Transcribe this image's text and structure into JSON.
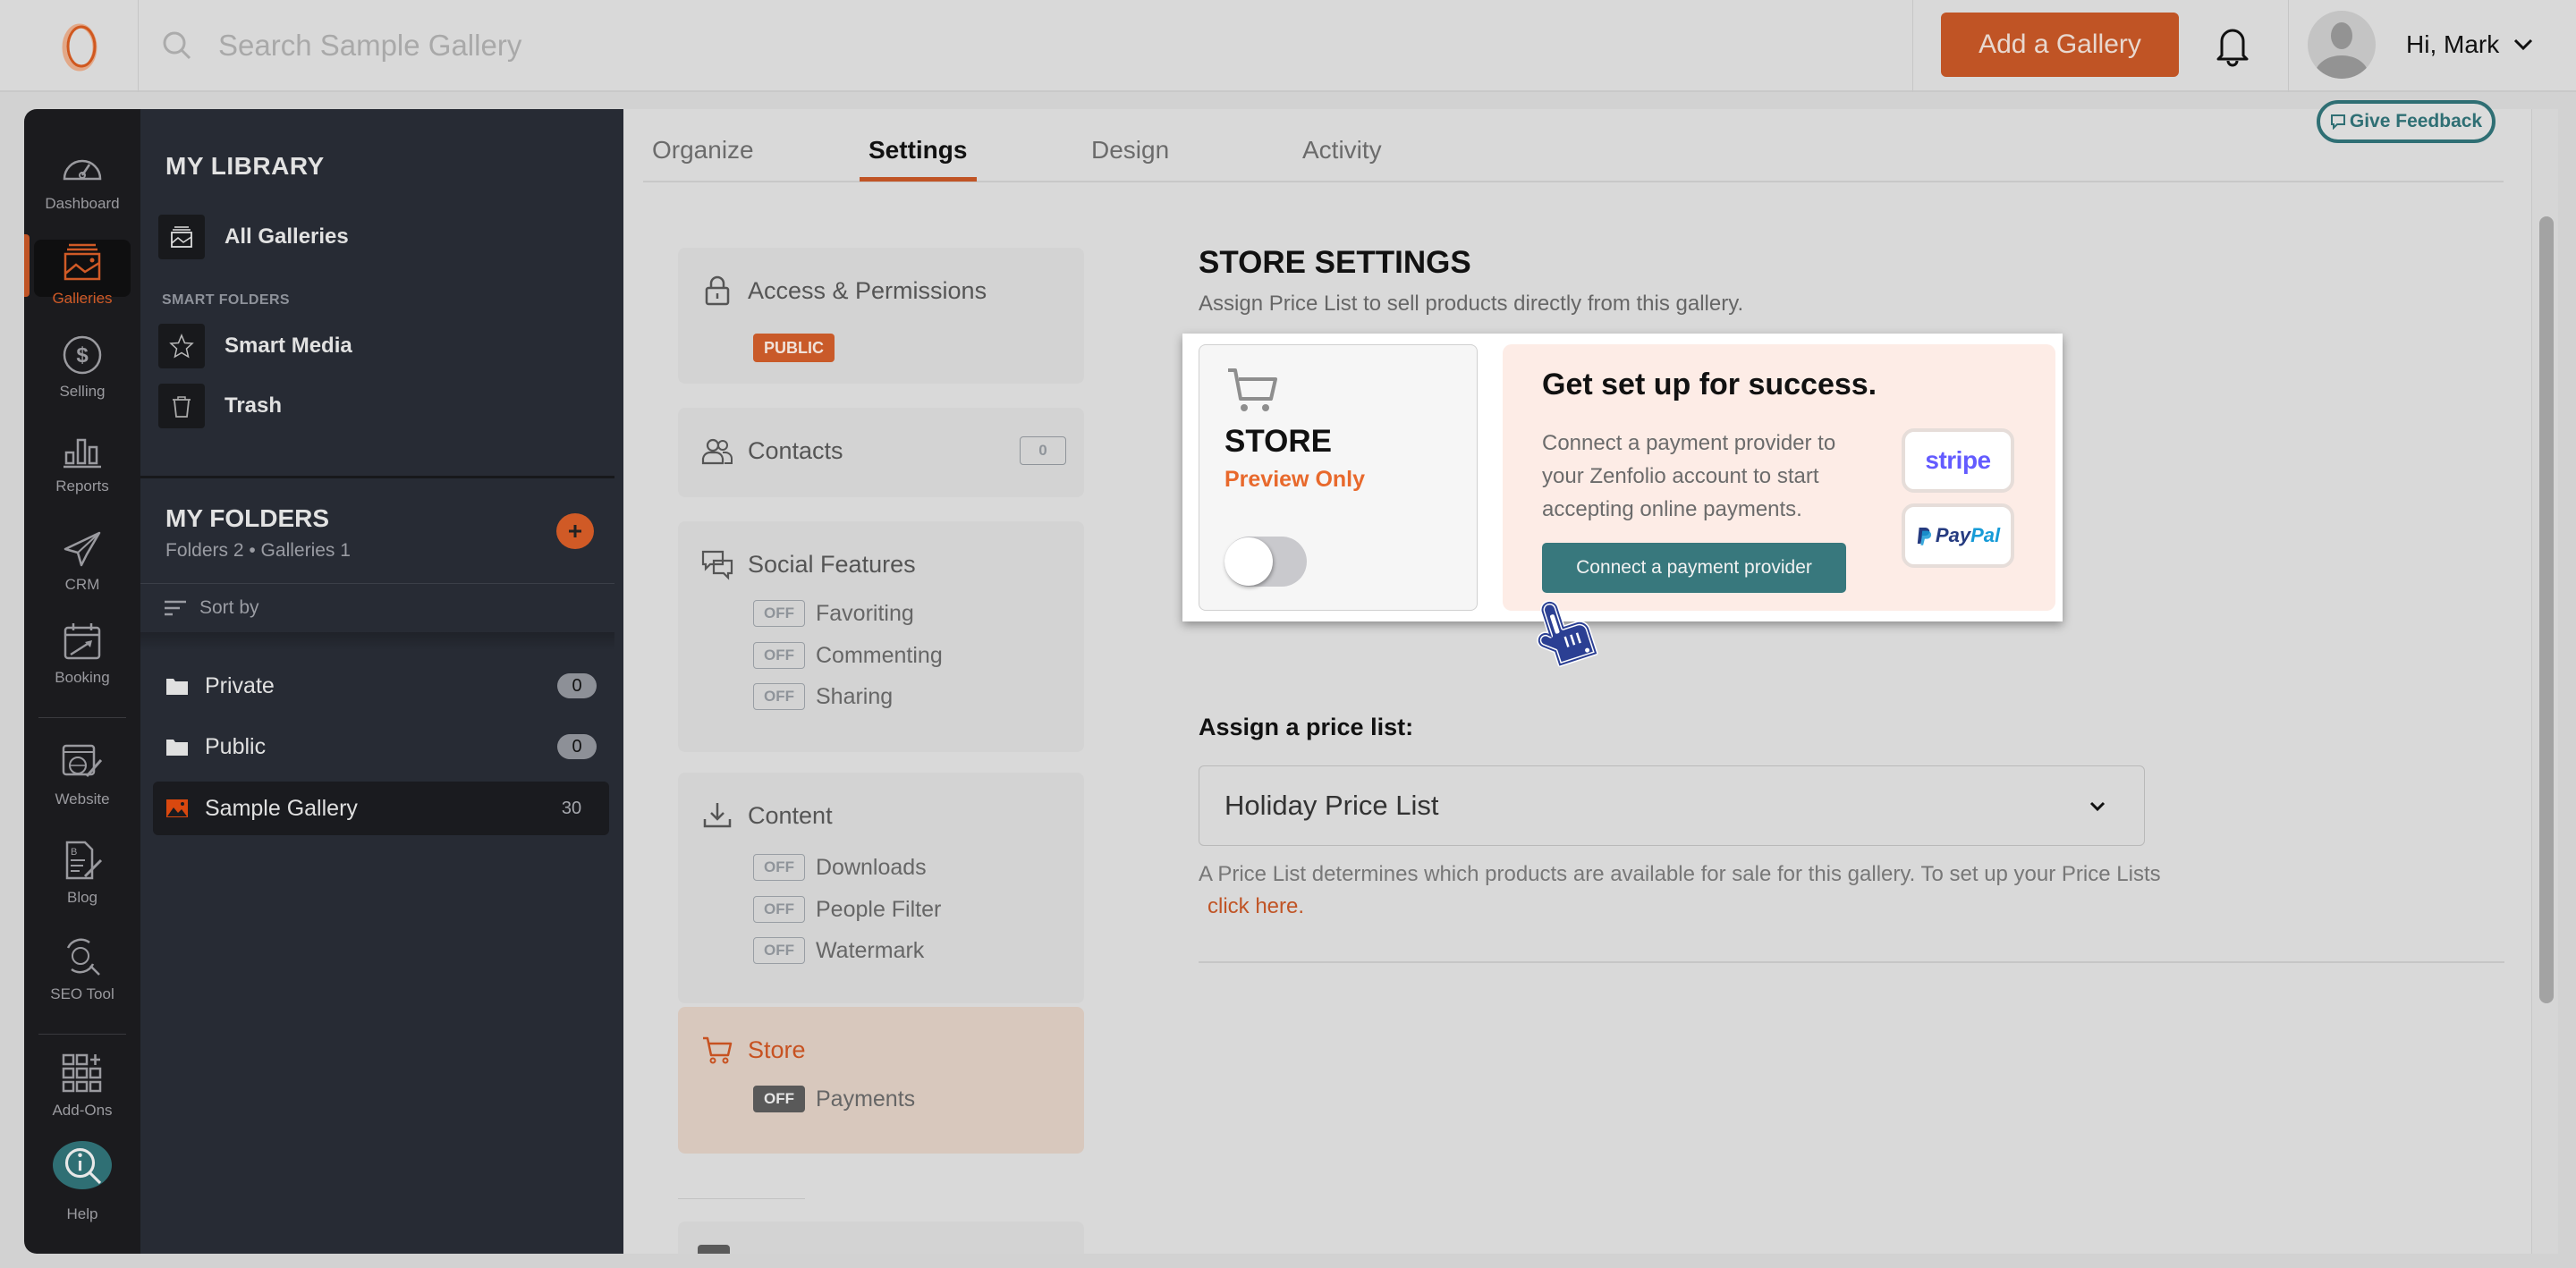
{
  "header": {
    "search_placeholder": "Search Sample Gallery",
    "add_gallery_label": "Add a Gallery",
    "user_greeting": "Hi, Mark",
    "feedback_label": "Give Feedback"
  },
  "rail": {
    "items": [
      {
        "label": "Dashboard",
        "icon": "dashboard-gauge-icon"
      },
      {
        "label": "Galleries",
        "icon": "galleries-icon",
        "active": true
      },
      {
        "label": "Selling",
        "icon": "dollar-icon"
      },
      {
        "label": "Reports",
        "icon": "bar-chart-icon"
      },
      {
        "label": "CRM",
        "icon": "paper-plane-icon"
      },
      {
        "label": "Booking",
        "icon": "calendar-icon"
      },
      {
        "label": "Website",
        "icon": "website-icon"
      },
      {
        "label": "Blog",
        "icon": "blog-icon"
      },
      {
        "label": "SEO Tool",
        "icon": "seo-icon"
      },
      {
        "label": "Add-Ons",
        "icon": "add-ons-grid-icon"
      },
      {
        "label": "Help",
        "icon": "help-icon"
      }
    ]
  },
  "library": {
    "title": "MY LIBRARY",
    "all_galleries": "All Galleries",
    "smart_folders_label": "SMART FOLDERS",
    "smart_media": "Smart Media",
    "trash": "Trash",
    "folders_title": "MY FOLDERS",
    "folders_summary": "Folders 2 • Galleries 1",
    "sort_label": "Sort by",
    "folders": [
      {
        "name": "Private",
        "count": "0",
        "type": "folder"
      },
      {
        "name": "Public",
        "count": "0",
        "type": "folder"
      },
      {
        "name": "Sample Gallery",
        "count": "30",
        "type": "gallery",
        "active": true
      }
    ]
  },
  "tabs": [
    {
      "label": "Organize"
    },
    {
      "label": "Settings",
      "active": true
    },
    {
      "label": "Design"
    },
    {
      "label": "Activity"
    }
  ],
  "settings_menu": {
    "access": {
      "label": "Access & Permissions",
      "badge": "PUBLIC"
    },
    "contacts": {
      "label": "Contacts",
      "count": "0"
    },
    "social": {
      "label": "Social Features",
      "items": [
        {
          "state": "OFF",
          "label": "Favoriting"
        },
        {
          "state": "OFF",
          "label": "Commenting"
        },
        {
          "state": "OFF",
          "label": "Sharing"
        }
      ]
    },
    "content": {
      "label": "Content",
      "items": [
        {
          "state": "OFF",
          "label": "Downloads"
        },
        {
          "state": "OFF",
          "label": "People Filter"
        },
        {
          "state": "OFF",
          "label": "Watermark"
        }
      ]
    },
    "store": {
      "label": "Store",
      "items": [
        {
          "state": "OFF",
          "label": "Payments"
        }
      ]
    }
  },
  "store_settings": {
    "title": "STORE SETTINGS",
    "subtitle": "Assign Price List to sell products directly from this gallery.",
    "store_card": {
      "label": "STORE",
      "mode": "Preview Only",
      "toggle_on": false
    },
    "promo": {
      "title": "Get set up for success.",
      "text": "Connect a payment provider to your Zenfolio account to start accepting online payments.",
      "button": "Connect a payment provider",
      "providers": [
        "stripe",
        "PayPal"
      ]
    },
    "price_list_label": "Assign a price list:",
    "price_list_value": "Holiday Price List",
    "price_help": "A Price List determines which products are available for sale for this gallery. To set up your Price Lists",
    "price_help_link": "click here."
  },
  "colors": {
    "accent": "#c05425",
    "teal": "#38787d",
    "rail_bg": "#1b1b1e",
    "library_bg": "#272b34"
  }
}
